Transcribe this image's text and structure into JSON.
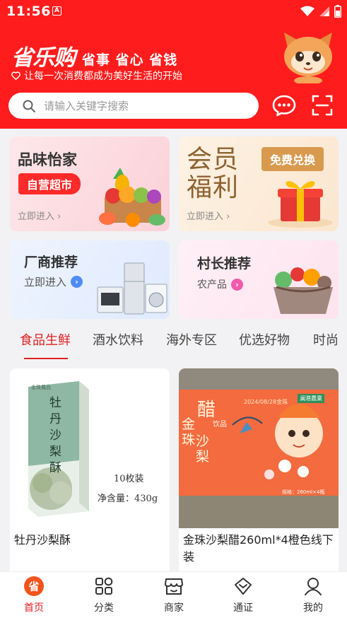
{
  "status_bar": {
    "time": "11:56",
    "notif_icon": "A"
  },
  "header": {
    "logo": "省乐购",
    "slogan": "省事  省心  省钱",
    "tagline": "让每一次消费都成为美好生活的开始",
    "bg_color": "#ff1c1c"
  },
  "search": {
    "placeholder": "请输入关键字搜索"
  },
  "promos": {
    "card1": {
      "title": "品味怡家",
      "badge": "自营超市",
      "enter": "立即进入 ›"
    },
    "card2": {
      "title_line1": "会员",
      "title_line2": "福利",
      "badge": "免费兑换",
      "enter": "立即进入 ›"
    },
    "card3": {
      "title": "厂商推荐",
      "sub": "立即进入",
      "arrow": "›"
    },
    "card4": {
      "title": "村长推荐",
      "sub": "农产品",
      "arrow": "›"
    }
  },
  "tabs": [
    "食品生鲜",
    "酒水饮料",
    "海外专区",
    "优选好物",
    "时尚"
  ],
  "active_tab": 0,
  "products": [
    {
      "name": "牡丹沙梨酥",
      "pack_title": "牡丹沙梨酥",
      "pack_brand": "金珠農品",
      "pack_count": "10枚装",
      "pack_weight": "净含量：430g"
    },
    {
      "name": "金珠沙梨醋260ml*4橙色线下装",
      "pack_title_a": "金珠",
      "pack_title_b": "沙梨",
      "pack_title_c": "醋",
      "pack_sub": "饮品",
      "pack_date": "2024/08/28金珠",
      "pack_spec": "规格：260ml×4瓶",
      "pack_brand": "澜港農業"
    }
  ],
  "bottom_nav": [
    {
      "label": "首页",
      "icon": "home-icon",
      "glyph": "省"
    },
    {
      "label": "分类",
      "icon": "category-icon"
    },
    {
      "label": "商家",
      "icon": "shop-icon"
    },
    {
      "label": "通证",
      "icon": "token-icon"
    },
    {
      "label": "我的",
      "icon": "profile-icon"
    }
  ],
  "colors": {
    "accent": "#e02020",
    "gold": "#d89a4f",
    "blue_dot": "#4f8cf5",
    "pink_dot": "#f05aa8"
  }
}
